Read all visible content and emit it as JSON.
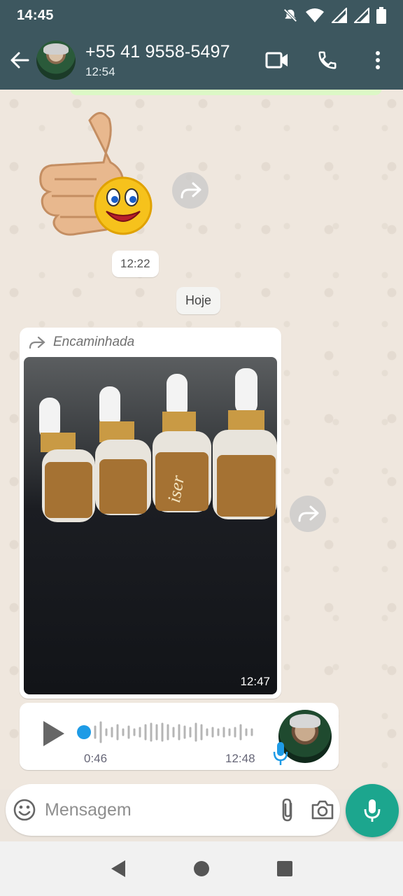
{
  "status_bar": {
    "time": "14:45"
  },
  "header": {
    "contact_name": "+55 41 9558-5497",
    "contact_status": "12:54"
  },
  "chat": {
    "sticker_time": "12:22",
    "date_divider": "Hoje",
    "image_message": {
      "forwarded_label": "Encaminhada",
      "time": "12:47",
      "product_brand": "iser"
    },
    "voice_message": {
      "duration": "0:46",
      "time": "12:48"
    }
  },
  "composer": {
    "placeholder": "Mensagem"
  },
  "colors": {
    "header_bg": "#3d575f",
    "accent_green": "#1ca68e",
    "voice_blue": "#1e9be6"
  }
}
